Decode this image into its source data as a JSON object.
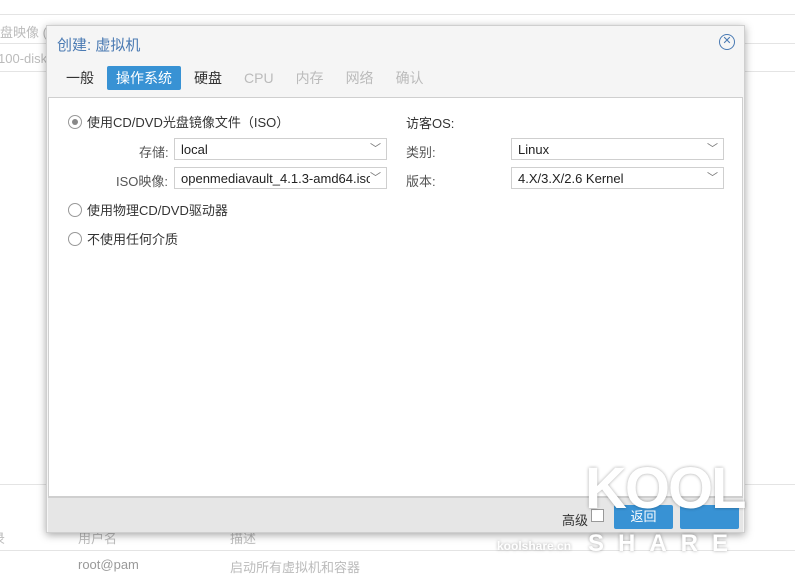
{
  "background": {
    "col1_fragment": "盘映像 (",
    "col2_fragment": "100-disk",
    "table_headers": [
      "录",
      "用户名",
      "描述"
    ],
    "row": [
      "root@pam",
      "启动所有虚拟机和容器"
    ]
  },
  "dialog": {
    "title": "创建: 虚拟机",
    "tabs": [
      {
        "label": "一般",
        "state": "normal"
      },
      {
        "label": "操作系统",
        "state": "active"
      },
      {
        "label": "硬盘",
        "state": "normal"
      },
      {
        "label": "CPU",
        "state": "disabled"
      },
      {
        "label": "内存",
        "state": "disabled"
      },
      {
        "label": "网络",
        "state": "disabled"
      },
      {
        "label": "确认",
        "state": "disabled"
      }
    ],
    "media": {
      "options": [
        "使用CD/DVD光盘镜像文件（ISO）",
        "使用物理CD/DVD驱动器",
        "不使用任何介质"
      ],
      "selected": 0,
      "storage_label": "存储:",
      "storage_value": "local",
      "iso_label": "ISO映像:",
      "iso_value": "openmediavault_4.1.3-amd64.iso"
    },
    "guest": {
      "heading": "访客OS:",
      "type_label": "类别:",
      "type_value": "Linux",
      "version_label": "版本:",
      "version_value": "4.X/3.X/2.6 Kernel"
    },
    "footer": {
      "advanced_label": "高级",
      "back_label": "返回",
      "next_label": ""
    }
  },
  "watermark": {
    "logo": "KOOL",
    "sub": "S H A R E",
    "site": "koolshare.cn"
  },
  "colors": {
    "accent": "#3892d4",
    "title": "#4a7ab3"
  }
}
